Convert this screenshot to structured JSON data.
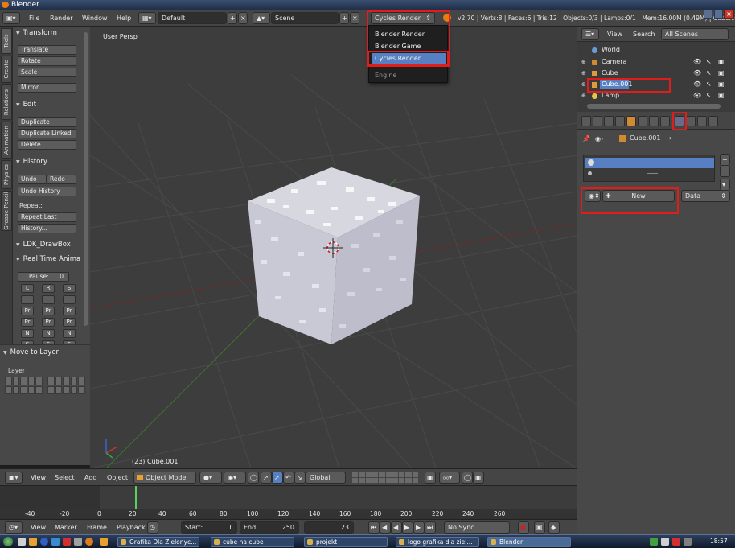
{
  "window": {
    "title": "Blender"
  },
  "info_header": {
    "menus": [
      "File",
      "Render",
      "Window",
      "Help"
    ],
    "screen_layout": "Default",
    "scene": "Scene",
    "render_engine": "Cycles Render",
    "stats": "v2.70 | Verts:8 | Faces:6 | Tris:12 | Objects:0/3 | Lamps:0/1 | Mem:16.00M (0.49M) | Cube.001"
  },
  "engine_dropdown": {
    "items": [
      "Blender Render",
      "Blender Game",
      "Cycles Render"
    ],
    "selected": "Cycles Render",
    "footer": "Engine"
  },
  "tool_tabs": [
    "Tools",
    "Create",
    "Relations",
    "Animation",
    "Physics",
    "Grease Pencil"
  ],
  "tool_panel": {
    "transform": {
      "title": "Transform",
      "buttons": [
        "Translate",
        "Rotate",
        "Scale",
        "Mirror"
      ]
    },
    "edit": {
      "title": "Edit",
      "buttons": [
        "Duplicate",
        "Duplicate Linked",
        "Delete"
      ]
    },
    "history": {
      "title": "History",
      "undo": "Undo",
      "redo": "Redo",
      "undo_history": "Undo History",
      "repeat_label": "Repeat:",
      "repeat_last": "Repeat Last",
      "history_btn": "History..."
    },
    "ldk": {
      "title": "LDK_DrawBox"
    },
    "realtime": {
      "title": "Real Time Anima",
      "pause_label": "Pause:",
      "pause_value": "0",
      "rows": [
        [
          "L",
          "R",
          "S"
        ],
        [
          "",
          "",
          ""
        ],
        [
          "Pr",
          "Pr",
          "Pr"
        ],
        [
          "Pr",
          "Pr",
          "Pr"
        ],
        [
          "N",
          "N",
          "N"
        ],
        [
          "S",
          "S",
          "S"
        ],
        [
          "",
          "",
          ""
        ]
      ]
    }
  },
  "layer_panel": {
    "title": "Move to Layer",
    "label": "Layer"
  },
  "viewport": {
    "view_label": "User Persp",
    "object_label": "(23) Cube.001"
  },
  "view_header": {
    "menus": [
      "View",
      "Select",
      "Add",
      "Object"
    ],
    "mode": "Object Mode",
    "orientation": "Global"
  },
  "timeline": {
    "ticks": [
      "-40",
      "-20",
      "0",
      "20",
      "40",
      "60",
      "80",
      "100",
      "120",
      "140",
      "160",
      "180",
      "200",
      "220",
      "240",
      "260"
    ],
    "current_frame": 23
  },
  "timeline_header": {
    "menus": [
      "View",
      "Marker",
      "Frame",
      "Playback"
    ],
    "start_label": "Start:",
    "start_value": "1",
    "end_label": "End:",
    "end_value": "250",
    "current_value": "23",
    "sync": "No Sync"
  },
  "outliner": {
    "view": "View",
    "search": "Search",
    "scenes": "All Scenes",
    "rows": [
      "World",
      "Camera",
      "Cube",
      "Cube.001",
      "Lamp"
    ],
    "selected": "Cube.001"
  },
  "properties": {
    "object": "Cube.001",
    "new_button": "New",
    "data_select": "Data"
  },
  "taskbar": {
    "items": [
      "Grafika Dla Zielonyc...",
      "cube na cube",
      "projekt",
      "logo grafika dla ziel...",
      "Blender"
    ],
    "clock": "18:57"
  },
  "colors": {
    "accent": "#e87d0d",
    "selection": "#5680c2",
    "highlight_box": "#e21b1b"
  }
}
